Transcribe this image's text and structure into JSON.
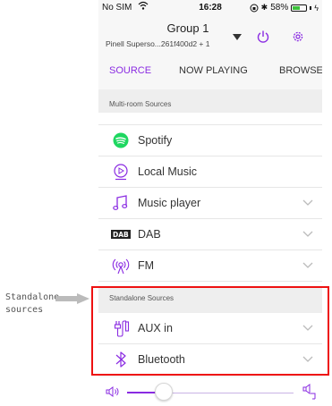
{
  "status_bar": {
    "carrier": "No SIM",
    "time": "16:28",
    "battery": "58%",
    "battery_level": 0.58
  },
  "header": {
    "group_title": "Group 1",
    "group_subtitle": "Pinell Superso...261f400d2 + 1"
  },
  "tabs": [
    {
      "label": "SOURCE",
      "active": true
    },
    {
      "label": "NOW PLAYING",
      "active": false
    },
    {
      "label": "BROWSE",
      "active": false
    }
  ],
  "multi_room": {
    "header": "Multi-room Sources",
    "items": [
      {
        "label": "Spotify",
        "icon": "spotify-icon",
        "expandable": false
      },
      {
        "label": "Local Music",
        "icon": "local-music-icon",
        "expandable": false
      },
      {
        "label": "Music player",
        "icon": "music-note-icon",
        "expandable": true
      },
      {
        "label": "DAB",
        "icon": "dab-icon",
        "expandable": true
      },
      {
        "label": "FM",
        "icon": "fm-radio-icon",
        "expandable": true
      }
    ]
  },
  "standalone": {
    "header": "Standalone Sources",
    "items": [
      {
        "label": "AUX in",
        "icon": "aux-cable-icon",
        "expandable": true
      },
      {
        "label": "Bluetooth",
        "icon": "bluetooth-icon",
        "expandable": true
      }
    ]
  },
  "volume": {
    "level": 0.22
  },
  "annotation": {
    "line1": "Standalone",
    "line2": "sources"
  },
  "colors": {
    "accent": "#8a2be2",
    "spotify": "#1ed760",
    "highlight": "#e11111"
  }
}
